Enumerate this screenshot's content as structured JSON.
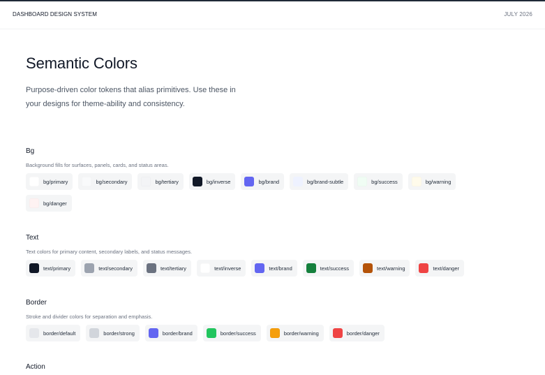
{
  "header": {
    "brand": "DASHBOARD DESIGN SYSTEM",
    "date": "JULY 2026"
  },
  "page": {
    "title": "Semantic Colors",
    "description": "Purpose-driven color tokens that alias primitives. Use these in your designs for theme-ability and consistency."
  },
  "sections": [
    {
      "heading": "Bg",
      "description": "Background fills for surfaces, panels, cards, and status areas.",
      "tokens": [
        {
          "label": "bg/primary",
          "color": "#ffffff"
        },
        {
          "label": "bg/secondary",
          "color": "#f9fafb"
        },
        {
          "label": "bg/tertiary",
          "color": "#f3f4f6"
        },
        {
          "label": "bg/inverse",
          "color": "#111827"
        },
        {
          "label": "bg/brand",
          "color": "#6366f1"
        },
        {
          "label": "bg/brand-subtle",
          "color": "#eef2ff"
        },
        {
          "label": "bg/success",
          "color": "#f0fdf4"
        },
        {
          "label": "bg/warning",
          "color": "#fffbeb"
        },
        {
          "label": "bg/danger",
          "color": "#fef2f2"
        }
      ]
    },
    {
      "heading": "Text",
      "description": "Text colors for primary content, secondary labels, and status messages.",
      "tokens": [
        {
          "label": "text/primary",
          "color": "#111827"
        },
        {
          "label": "text/secondary",
          "color": "#9ca3af"
        },
        {
          "label": "text/tertiary",
          "color": "#6b7280"
        },
        {
          "label": "text/inverse",
          "color": "#ffffff"
        },
        {
          "label": "text/brand",
          "color": "#6366f1"
        },
        {
          "label": "text/success",
          "color": "#15803d"
        },
        {
          "label": "text/warning",
          "color": "#b45309"
        },
        {
          "label": "text/danger",
          "color": "#ef4444"
        }
      ]
    },
    {
      "heading": "Border",
      "description": "Stroke and divider colors for separation and emphasis.",
      "tokens": [
        {
          "label": "border/default",
          "color": "#e5e7eb"
        },
        {
          "label": "border/strong",
          "color": "#d1d5db"
        },
        {
          "label": "border/brand",
          "color": "#6366f1"
        },
        {
          "label": "border/success",
          "color": "#22c55e"
        },
        {
          "label": "border/warning",
          "color": "#f59e0b"
        },
        {
          "label": "border/danger",
          "color": "#ef4444"
        }
      ]
    },
    {
      "heading": "Action",
      "description": "",
      "tokens": []
    }
  ]
}
